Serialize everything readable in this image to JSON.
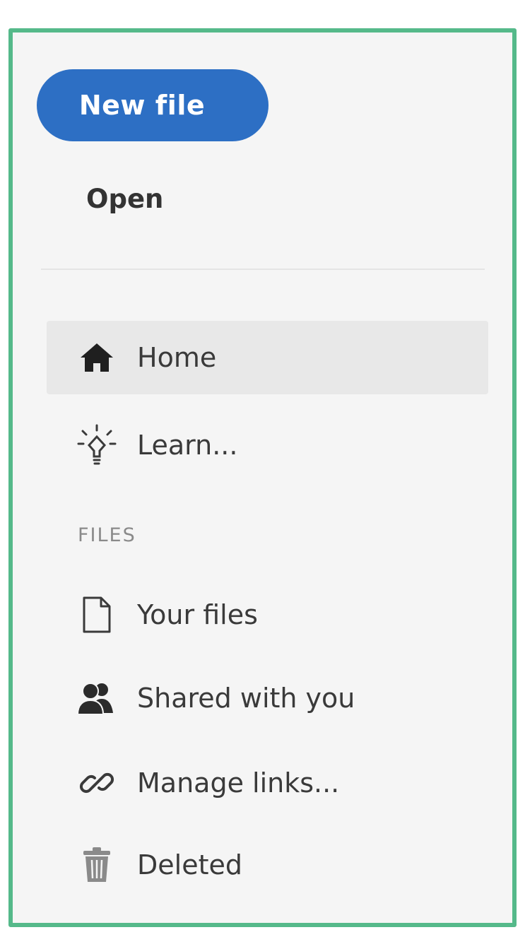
{
  "sidebar": {
    "new_file_label": "New file",
    "open_label": "Open",
    "primary_items": [
      {
        "label": "Home",
        "icon": "home-icon",
        "active": true
      },
      {
        "label": "Learn...",
        "icon": "lightbulb-icon",
        "active": false
      }
    ],
    "files_section_label": "FILES",
    "file_items": [
      {
        "label": "Your files",
        "icon": "file-icon"
      },
      {
        "label": "Shared with you",
        "icon": "people-icon"
      },
      {
        "label": "Manage links...",
        "icon": "link-icon"
      },
      {
        "label": "Deleted",
        "icon": "trash-icon"
      }
    ]
  },
  "colors": {
    "accent": "#2d6fc4",
    "frame_border": "#55b98a",
    "panel_background": "#f5f5f5",
    "active_item_background": "#e8e8e8"
  }
}
